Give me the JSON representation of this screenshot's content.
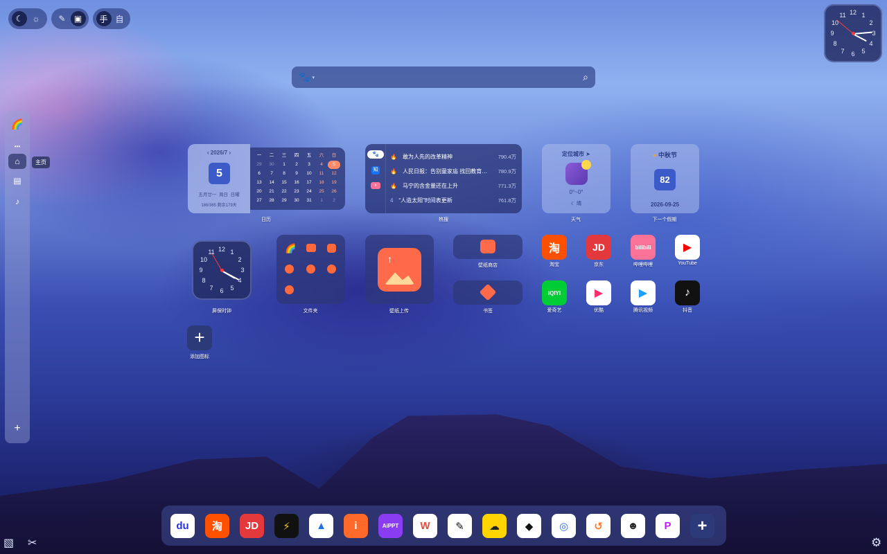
{
  "toolbar": {
    "theme_dark_icon": "moon-icon",
    "theme_light_icon": "sun-icon",
    "edit_icon": "edit-icon",
    "folder_icon": "folder-icon",
    "mode_manual": "手",
    "mode_auto": "自"
  },
  "top_clock": {
    "numbers": [
      "12",
      "1",
      "2",
      "3",
      "4",
      "5",
      "6",
      "7",
      "8",
      "9",
      "10",
      "11"
    ]
  },
  "sidebar": {
    "more": "•••",
    "items": [
      {
        "icon": "home-icon",
        "label": "主页"
      },
      {
        "icon": "briefcase-icon",
        "label": ""
      },
      {
        "icon": "music-icon",
        "label": ""
      }
    ],
    "add": "+"
  },
  "search": {
    "placeholder": ""
  },
  "calendar": {
    "month": "2026/7",
    "day": "5",
    "lunar": "五月廿一",
    "weekday": "周日",
    "solar_term": "",
    "extra": "日曜",
    "progress": "186/365 剩余179天",
    "weekdays": [
      "一",
      "二",
      "三",
      "四",
      "五",
      "六",
      "日"
    ],
    "days": [
      "29",
      "30",
      "1",
      "2",
      "3",
      "4",
      "5",
      "6",
      "7",
      "8",
      "9",
      "10",
      "11",
      "12",
      "13",
      "14",
      "15",
      "16",
      "17",
      "18",
      "19",
      "20",
      "21",
      "22",
      "23",
      "24",
      "25",
      "26",
      "27",
      "28",
      "29",
      "30",
      "31",
      "1",
      "2"
    ],
    "caption": "日历"
  },
  "hot": {
    "caption": "热搜",
    "tabs": [
      "baidu-icon",
      "zhihu-icon",
      "bilibili-icon"
    ],
    "rows": [
      {
        "rank": "🔥",
        "title": "敢为人先的改革精神",
        "value": "790.4万"
      },
      {
        "rank": "🔥",
        "title": "人民日报：告别童家庙 找回教育…",
        "value": "780.9万"
      },
      {
        "rank": "🔥",
        "title": "马宁的含金量还在上升",
        "value": "771.3万"
      },
      {
        "rank": "4",
        "title": "“人造太阳”时间表更新",
        "value": "761.8万"
      }
    ]
  },
  "weather": {
    "city": "定位城市",
    "temp": "0°~0°",
    "cond": "晴",
    "caption": "天气"
  },
  "holiday": {
    "name": "中秋节",
    "days": "82",
    "date": "2026-09-25",
    "caption": "下一个假期"
  },
  "clock_widget": {
    "caption": "屏保时钟",
    "numbers": [
      "12",
      "1",
      "2",
      "3",
      "4",
      "5",
      "6",
      "7",
      "8",
      "9",
      "10",
      "11"
    ]
  },
  "folder": {
    "caption": "文件夹"
  },
  "wallpaper_upload": {
    "caption": "壁纸上传"
  },
  "wallpaper_store": {
    "caption": "壁纸商店"
  },
  "bookmark": {
    "caption": "书签"
  },
  "add_icon": {
    "caption": "添加图标",
    "glyph": "+"
  },
  "apps": [
    {
      "label": "淘宝",
      "glyph": "淘",
      "color": "#ff5000"
    },
    {
      "label": "京东",
      "glyph": "JD",
      "color": "#e4393c"
    },
    {
      "label": "哔哩哔哩",
      "glyph": "bilibili",
      "color": "#fb7299"
    },
    {
      "label": "YouTube",
      "glyph": "▶",
      "color": "#ffffff"
    },
    {
      "label": "爱奇艺",
      "glyph": "iQIYI",
      "color": "#00cc36"
    },
    {
      "label": "优酷",
      "glyph": "▶",
      "color": "#ffffff"
    },
    {
      "label": "腾讯视频",
      "glyph": "▶",
      "color": "#ffffff"
    },
    {
      "label": "抖音",
      "glyph": "♪",
      "color": "#111111"
    }
  ],
  "dock": [
    {
      "name": "baidu",
      "glyph": "du",
      "color": "#ffffff",
      "fg": "#2932e1"
    },
    {
      "name": "taobao",
      "glyph": "淘",
      "color": "#ff5000",
      "fg": "#ffffff"
    },
    {
      "name": "jd",
      "glyph": "JD",
      "color": "#e4393c",
      "fg": "#ffffff"
    },
    {
      "name": "zhuanyeji",
      "glyph": "⚡",
      "color": "#111111",
      "fg": "#f5c518"
    },
    {
      "name": "arrow",
      "glyph": "▲",
      "color": "#ffffff",
      "fg": "#1e6fe8"
    },
    {
      "name": "i",
      "glyph": "i",
      "color": "#ff6a2b",
      "fg": "#ffffff"
    },
    {
      "name": "aippt",
      "glyph": "AiPPT",
      "color": "#8a3cf0",
      "fg": "#ffffff"
    },
    {
      "name": "wps",
      "glyph": "W",
      "color": "#ffffff",
      "fg": "#e84c3d"
    },
    {
      "name": "pen",
      "glyph": "✎",
      "color": "#ffffff",
      "fg": "#111111"
    },
    {
      "name": "cloud",
      "glyph": "☁",
      "color": "#ffd400",
      "fg": "#222222"
    },
    {
      "name": "kuaishou",
      "glyph": "◆",
      "color": "#ffffff",
      "fg": "#111111"
    },
    {
      "name": "circle",
      "glyph": "◎",
      "color": "#ffffff",
      "fg": "#2a6df4"
    },
    {
      "name": "swirl",
      "glyph": "↺",
      "color": "#ffffff",
      "fg": "#ff7a2b"
    },
    {
      "name": "raccoon",
      "glyph": "☻",
      "color": "#ffffff",
      "fg": "#222222"
    },
    {
      "name": "pd",
      "glyph": "P",
      "color": "#ffffff",
      "fg": "#c41aff"
    },
    {
      "name": "add",
      "glyph": "+",
      "color": "#2c3a7a",
      "fg": "#ffffff"
    }
  ],
  "bottom_icons": [
    "image-icon",
    "brush-icon",
    "gear-icon"
  ]
}
